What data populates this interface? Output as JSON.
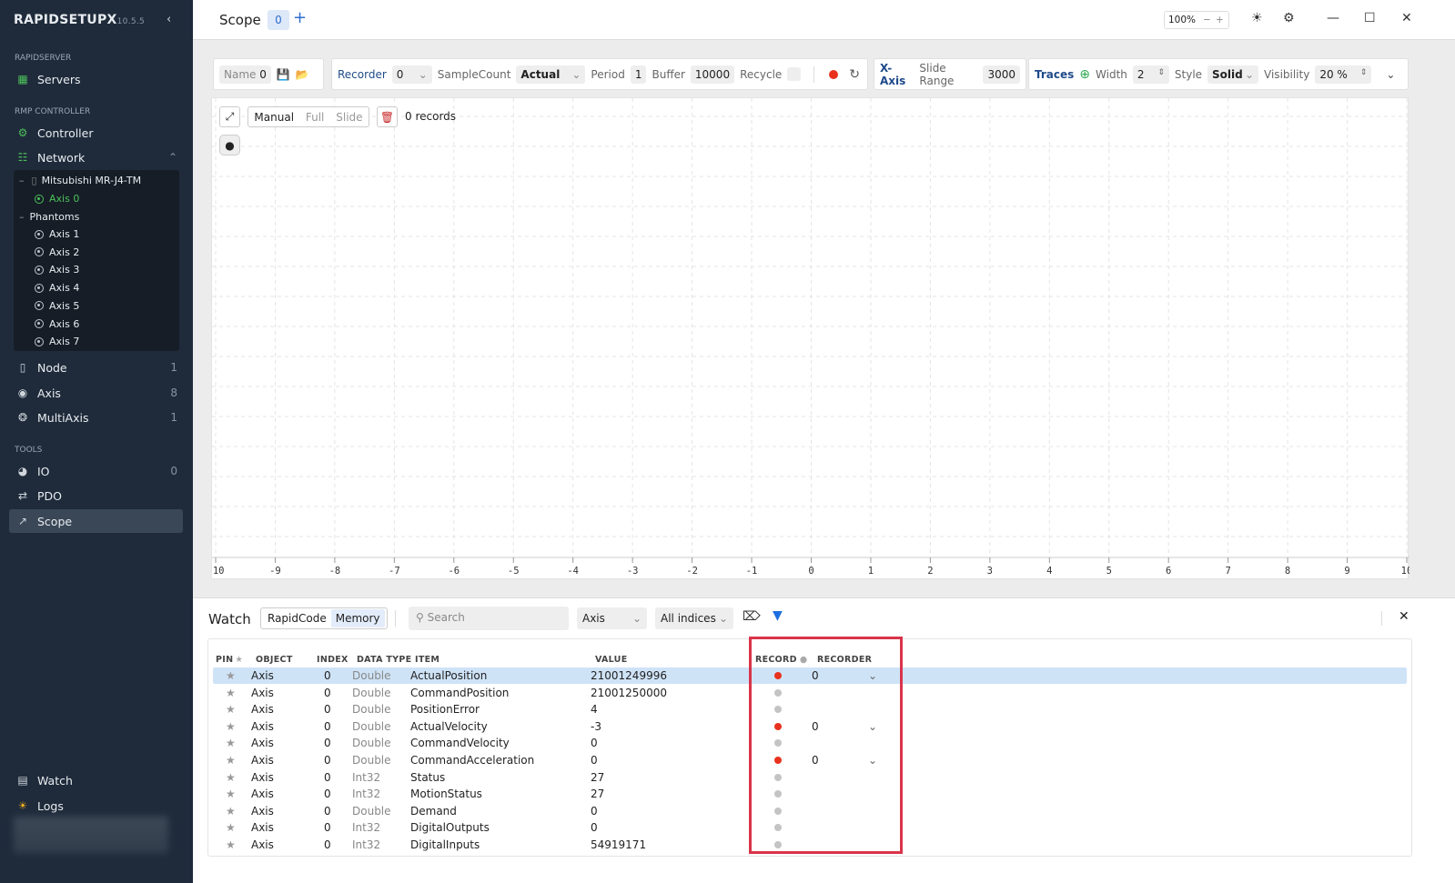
{
  "app": {
    "name": "RAPIDSETUPX",
    "version": "10.5.5"
  },
  "sidebar": {
    "sections": {
      "rapidserver": "RAPIDSERVER",
      "rmp": "RMP CONTROLLER",
      "tools": "TOOLS"
    },
    "servers": "Servers",
    "controller": "Controller",
    "network": "Network",
    "tree": {
      "device": "Mitsubishi MR-J4-TM",
      "device_axis": "Axis 0",
      "phantoms": "Phantoms",
      "phantom_axes": [
        "Axis 1",
        "Axis 2",
        "Axis 3",
        "Axis 4",
        "Axis 5",
        "Axis 6",
        "Axis 7"
      ]
    },
    "node": {
      "label": "Node",
      "count": "1"
    },
    "axis": {
      "label": "Axis",
      "count": "8"
    },
    "multiaxis": {
      "label": "MultiAxis",
      "count": "1"
    },
    "io": {
      "label": "IO",
      "count": "0"
    },
    "pdo": "PDO",
    "scope": "Scope",
    "watch": "Watch",
    "logs": "Logs"
  },
  "header": {
    "title": "Scope",
    "tab_count": "0",
    "zoom": "100%"
  },
  "toolbar": {
    "name_label": "Name",
    "name_value": "0",
    "recorder_label": "Recorder",
    "recorder_value": "0",
    "samplecount_label": "SampleCount",
    "samplecount_value": "Actual",
    "period_label": "Period",
    "period_value": "1",
    "buffer_label": "Buffer",
    "buffer_value": "10000",
    "recycle_label": "Recycle",
    "xaxis_label": "X-Axis",
    "slide_range_label": "Slide Range",
    "slide_range_value": "3000",
    "traces_label": "Traces",
    "width_label": "Width",
    "width_value": "2",
    "style_label": "Style",
    "style_value": "Solid",
    "visibility_label": "Visibility",
    "visibility_value": "20 %"
  },
  "plot": {
    "modes": [
      "Manual",
      "Full",
      "Slide"
    ],
    "active_mode": "Manual",
    "records": "0 records",
    "x_ticks": [
      -10,
      -9,
      -8,
      -7,
      -6,
      -5,
      -4,
      -3,
      -2,
      -1,
      0,
      1,
      2,
      3,
      4,
      5,
      6,
      7,
      8,
      9,
      10
    ]
  },
  "watch": {
    "title": "Watch",
    "tabs": [
      "RapidCode",
      "Memory"
    ],
    "active_tab": "Memory",
    "search_placeholder": "Search",
    "object_filter": "Axis",
    "index_filter": "All indices",
    "columns": [
      "PIN",
      "OBJECT",
      "INDEX",
      "DATA TYPE",
      "ITEM",
      "VALUE",
      "RECORD",
      "RECORDER"
    ],
    "rows": [
      {
        "object": "Axis",
        "index": "0",
        "type": "Double",
        "item": "ActualPosition",
        "value": "21001249996",
        "record": true,
        "recorder": "0",
        "selected": true
      },
      {
        "object": "Axis",
        "index": "0",
        "type": "Double",
        "item": "CommandPosition",
        "value": "21001250000",
        "record": false
      },
      {
        "object": "Axis",
        "index": "0",
        "type": "Double",
        "item": "PositionError",
        "value": "4",
        "record": false
      },
      {
        "object": "Axis",
        "index": "0",
        "type": "Double",
        "item": "ActualVelocity",
        "value": "-3",
        "record": true,
        "recorder": "0"
      },
      {
        "object": "Axis",
        "index": "0",
        "type": "Double",
        "item": "CommandVelocity",
        "value": "0",
        "record": false
      },
      {
        "object": "Axis",
        "index": "0",
        "type": "Double",
        "item": "CommandAcceleration",
        "value": "0",
        "record": true,
        "recorder": "0"
      },
      {
        "object": "Axis",
        "index": "0",
        "type": "Int32",
        "item": "Status",
        "value": "27",
        "record": false
      },
      {
        "object": "Axis",
        "index": "0",
        "type": "Int32",
        "item": "MotionStatus",
        "value": "27",
        "record": false
      },
      {
        "object": "Axis",
        "index": "0",
        "type": "Double",
        "item": "Demand",
        "value": "0",
        "record": false
      },
      {
        "object": "Axis",
        "index": "0",
        "type": "Int32",
        "item": "DigitalOutputs",
        "value": "0",
        "record": false
      },
      {
        "object": "Axis",
        "index": "0",
        "type": "Int32",
        "item": "DigitalInputs",
        "value": "54919171",
        "record": false
      }
    ]
  },
  "colors": {
    "sidebar": "#1f2b3b",
    "accent": "#2e6fd0",
    "green": "#4cc05a",
    "record_on": "#e8321e",
    "highlight": "#d9344a"
  }
}
